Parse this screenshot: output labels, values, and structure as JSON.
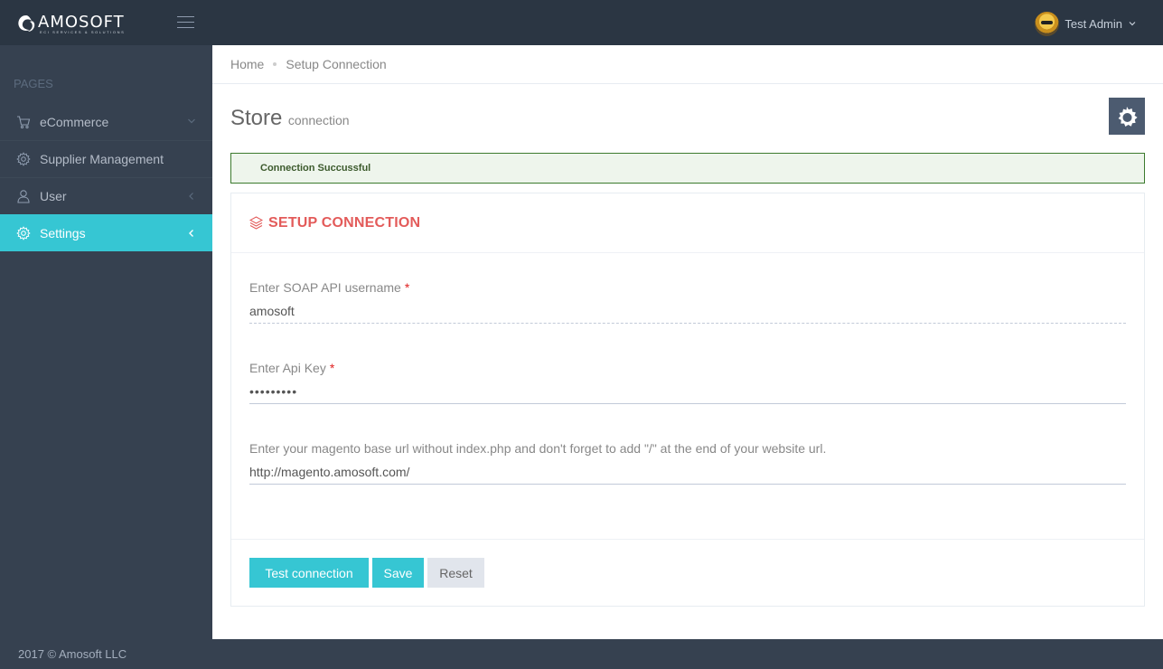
{
  "header": {
    "logo_text": "AMOSOFT",
    "logo_subtext": "ECI SERVICES & SOLUTIONS",
    "user_name": "Test Admin"
  },
  "sidebar": {
    "heading": "PAGES",
    "items": [
      {
        "label": "eCommerce",
        "icon": "cart-icon",
        "arrow": "chevron-down"
      },
      {
        "label": "Supplier Management",
        "icon": "gear-icon",
        "arrow": ""
      },
      {
        "label": "User",
        "icon": "user-icon",
        "arrow": "chevron-left"
      },
      {
        "label": "Settings",
        "icon": "gear-icon",
        "arrow": "chevron-left",
        "active": true
      }
    ]
  },
  "breadcrumb": {
    "home": "Home",
    "current": "Setup Connection"
  },
  "page": {
    "title": "Store",
    "subtitle": "connection"
  },
  "alert": {
    "message": "Connection Succussful"
  },
  "portlet": {
    "title": "SETUP CONNECTION",
    "fields": [
      {
        "label": "Enter SOAP API username",
        "required": "*",
        "value": "amosoft"
      },
      {
        "label": "Enter Api Key",
        "required": "*",
        "value": "•••••••••"
      },
      {
        "label": "Enter your magento base url without index.php and don't forget to add \"/\" at the end of your website url.",
        "value": "http://magento.amosoft.com/"
      }
    ],
    "buttons": {
      "test": "Test connection",
      "save": "Save",
      "reset": "Reset"
    }
  },
  "footer": {
    "text": "2017 © Amosoft LLC"
  },
  "colors": {
    "accent": "#36c6d3",
    "sidebar_bg": "#364150",
    "header_bg": "#2b3643",
    "title_red": "#e35b5a",
    "alert_border": "#3c7a2e"
  }
}
